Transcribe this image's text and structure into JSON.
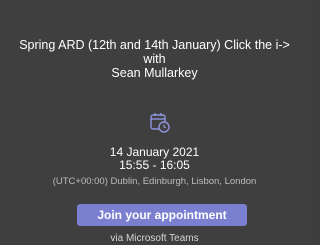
{
  "appointment": {
    "title_line1": "Spring ARD (12th and 14th January) Click the i->",
    "title_line2": "with",
    "title_line3": "Sean Mullarkey",
    "icon": "calendar-clock-icon",
    "date": "14 January 2021",
    "time": "15:55 - 16:05",
    "timezone": "(UTC+00:00) Dublin, Edinburgh, Lisbon, London",
    "join_label": "Join your appointment",
    "via": "via Microsoft Teams"
  },
  "colors": {
    "background": "#3f3f3f",
    "accent": "#7b7fd0",
    "icon": "#8f93dd"
  }
}
